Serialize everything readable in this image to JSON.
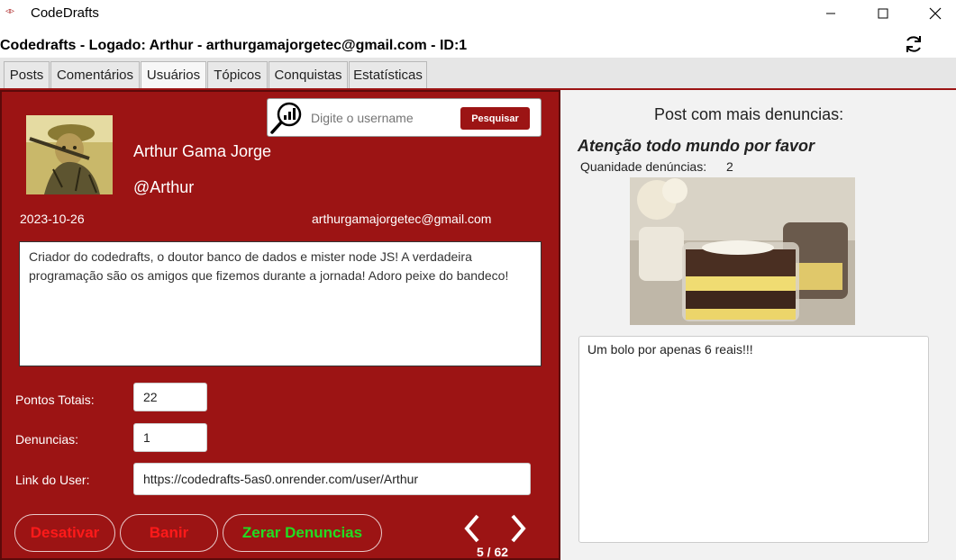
{
  "window": {
    "app_title": "CodeDrafts",
    "icon": "codedrafts-logo-icon",
    "controls": [
      "minimize-icon",
      "maximize-icon",
      "close-icon"
    ]
  },
  "header": {
    "info": "Codedrafts - Logado: Arthur - arthurgamajorgetec@gmail.com - ID:1",
    "refresh_icon": "refresh-icon"
  },
  "tabs": [
    {
      "label": "Posts",
      "active": false
    },
    {
      "label": "Comentários",
      "active": false
    },
    {
      "label": "Usuários",
      "active": true
    },
    {
      "label": "Tópicos",
      "active": false
    },
    {
      "label": "Conquistas",
      "active": false
    },
    {
      "label": "Estatísticas",
      "active": false
    }
  ],
  "user": {
    "full_name": "Arthur Gama Jorge",
    "username": "@Arthur",
    "date": "2023-10-26",
    "email": "arthurgamajorgetec@gmail.com",
    "bio": "Criador do codedrafts, o doutor banco de dados e mister node JS! A verdadeira programação são os amigos que fizemos durante a jornada! Adoro peixe do bandeco!",
    "avatar": "avatar-image"
  },
  "search": {
    "placeholder": "Digite o username",
    "button_label": "Pesquisar",
    "icon": "search-stats-icon"
  },
  "fields": {
    "points_label": "Pontos Totais:",
    "points_value": "22",
    "reports_label": "Denuncias:",
    "reports_value": "1",
    "link_label": "Link do User:",
    "link_value": "https://codedrafts-5as0.onrender.com/user/Arthur"
  },
  "actions": {
    "deactivate": "Desativar",
    "ban": "Banir",
    "reset_reports": "Zerar Denuncias"
  },
  "pagination": {
    "counter": "5 / 62",
    "prev_icon": "chevron-left-icon",
    "next_icon": "chevron-right-icon"
  },
  "colors": {
    "panel": "#9c1414",
    "danger_text": "#ff1a1a",
    "success_text": "#22dd22"
  },
  "most_reported": {
    "heading": "Post com mais denuncias:",
    "title": "Atenção todo mundo por favor",
    "count_label": "Quanidade denúncias:",
    "count_value": "2",
    "image": "dessert-photo",
    "body": "Um bolo por apenas 6 reais!!!"
  }
}
